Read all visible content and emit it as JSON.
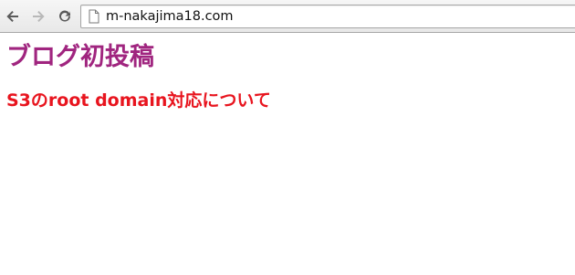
{
  "browser": {
    "url": "m-nakajima18.com",
    "back_icon": "back-arrow-icon",
    "forward_icon": "forward-arrow-icon",
    "reload_icon": "reload-icon",
    "page_icon": "page-icon"
  },
  "page": {
    "blog_title": "ブログ初投稿",
    "post_title": "S3のroot domain対応について"
  },
  "colors": {
    "blog_title": "#a0257f",
    "post_title": "#e8141e"
  }
}
